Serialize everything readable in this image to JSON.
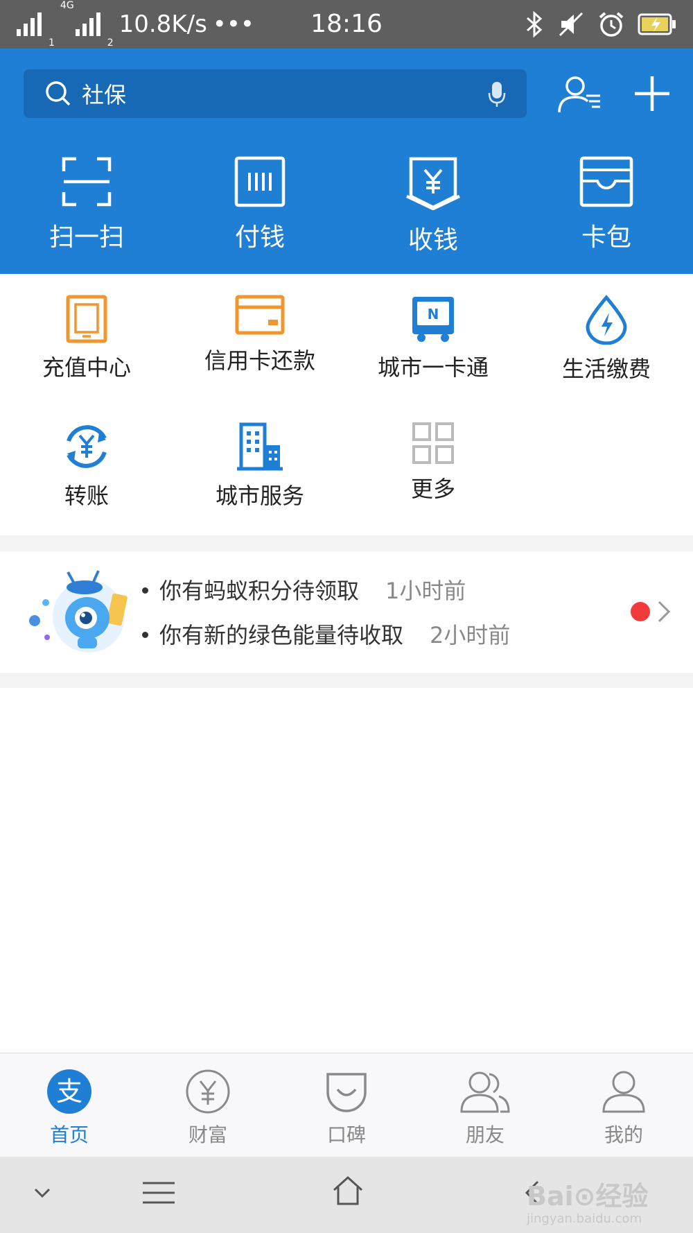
{
  "status_bar": {
    "network_type": "4G",
    "sim1": "1",
    "sim2": "2",
    "speed": "10.8K/s",
    "more": "•••",
    "time": "18:16"
  },
  "search": {
    "text": "社保"
  },
  "quick_actions": [
    {
      "label": "扫一扫",
      "icon": "scan-icon"
    },
    {
      "label": "付钱",
      "icon": "pay-code-icon"
    },
    {
      "label": "收钱",
      "icon": "receive-money-icon"
    },
    {
      "label": "卡包",
      "icon": "card-wallet-icon"
    }
  ],
  "services": [
    {
      "label": "充值中心",
      "icon": "phone-recharge-icon",
      "color": "#f0962e"
    },
    {
      "label": "信用卡还款",
      "icon": "credit-card-icon",
      "color": "#f0962e"
    },
    {
      "label": "城市一卡通",
      "icon": "transit-card-icon",
      "color": "#1f7fd4"
    },
    {
      "label": "生活缴费",
      "icon": "utility-bill-icon",
      "color": "#1f7fd4"
    },
    {
      "label": "转账",
      "icon": "transfer-icon",
      "color": "#1f7fd4"
    },
    {
      "label": "城市服务",
      "icon": "city-service-icon",
      "color": "#1f7fd4"
    },
    {
      "label": "更多",
      "icon": "more-grid-icon",
      "color": "#bbbbbb"
    }
  ],
  "notices": [
    {
      "text": "你有蚂蚁积分待领取",
      "time": "1小时前"
    },
    {
      "text": "你有新的绿色能量待收取",
      "time": "2小时前"
    }
  ],
  "tabs": [
    {
      "label": "首页",
      "icon": "alipay-home-icon",
      "active": true
    },
    {
      "label": "财富",
      "icon": "wealth-yen-icon",
      "active": false
    },
    {
      "label": "口碑",
      "icon": "koubei-icon",
      "active": false
    },
    {
      "label": "朋友",
      "icon": "friends-icon",
      "active": false
    },
    {
      "label": "我的",
      "icon": "profile-icon",
      "active": false
    }
  ],
  "watermark": {
    "brand": "Bai⊙经验",
    "site": "jingyan.baidu.com"
  },
  "colors": {
    "primary": "#1f7fd4",
    "search_bg": "#1869b5",
    "orange": "#f0962e",
    "badge_red": "#f23a3a"
  }
}
